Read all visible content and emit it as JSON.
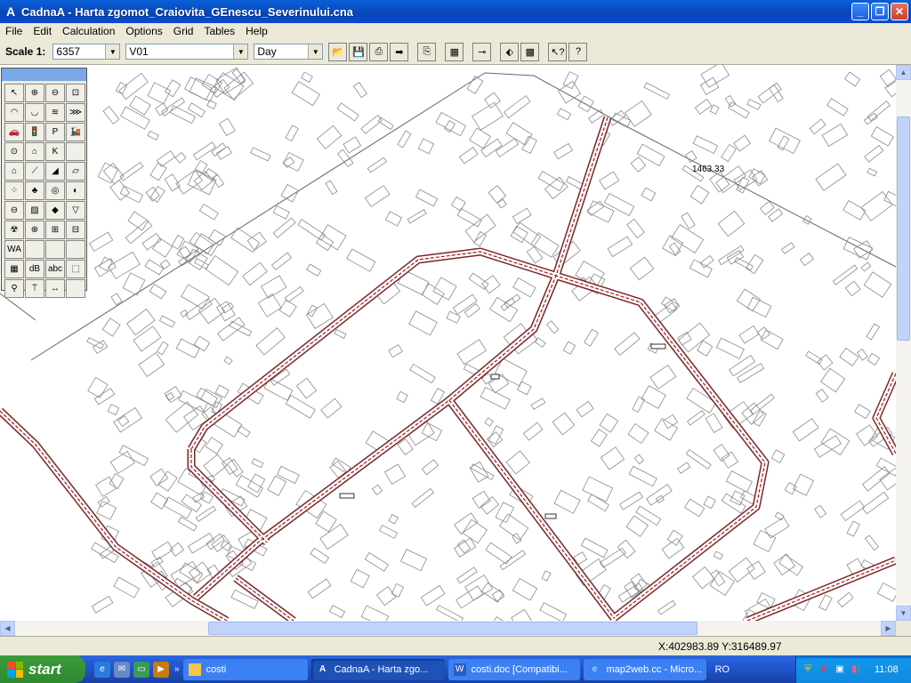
{
  "window": {
    "app_icon": "A",
    "title": "CadnaA - Harta zgomot_Craiovita_GEnescu_Severinului.cna",
    "buttons": [
      "minimize",
      "maximize",
      "close"
    ]
  },
  "menu": [
    "File",
    "Edit",
    "Calculation",
    "Options",
    "Grid",
    "Tables",
    "Help"
  ],
  "toolbar": {
    "scale_label": "Scale 1:",
    "scale_value": "6357",
    "variant_value": "V01",
    "period_value": "Day",
    "tool_icons": [
      "open-icon",
      "save-icon",
      "print-icon",
      "export-icon",
      "copy-icon",
      "calculator-icon",
      "pin-icon",
      "tag-icon",
      "grid-icon",
      "help-pointer-icon",
      "help-icon"
    ]
  },
  "map": {
    "label": "1463.33",
    "road_color": "#8b1a1a",
    "line_color": "#707070"
  },
  "palette": {
    "tools": [
      {
        "name": "select-arrow-icon",
        "glyph": "↖"
      },
      {
        "name": "zoom-in-icon",
        "glyph": "⊕"
      },
      {
        "name": "zoom-out-icon",
        "glyph": "⊖"
      },
      {
        "name": "zoom-extents-icon",
        "glyph": "⊡"
      },
      {
        "name": "point-source-icon",
        "glyph": "◠"
      },
      {
        "name": "line-source-icon",
        "glyph": "◡"
      },
      {
        "name": "area-source-icon",
        "glyph": "≋"
      },
      {
        "name": "vertical-area-source-icon",
        "glyph": "⋙"
      },
      {
        "name": "road-car-icon",
        "glyph": "🚗"
      },
      {
        "name": "traffic-light-icon",
        "glyph": "🚦"
      },
      {
        "name": "parking-icon",
        "glyph": "P"
      },
      {
        "name": "railway-icon",
        "glyph": "🚂"
      },
      {
        "name": "industry-icon",
        "glyph": "⊙"
      },
      {
        "name": "tunnel-icon",
        "glyph": "⌂"
      },
      {
        "name": "k-icon",
        "glyph": "K"
      },
      {
        "name": "blank-tool-1",
        "glyph": ""
      },
      {
        "name": "building-icon",
        "glyph": "⌂"
      },
      {
        "name": "barrier-icon",
        "glyph": "⟋"
      },
      {
        "name": "embankment-icon",
        "glyph": "◢"
      },
      {
        "name": "cylinder-icon",
        "glyph": "▱"
      },
      {
        "name": "scatter-points-icon",
        "glyph": "⁘"
      },
      {
        "name": "trees-icon",
        "glyph": "♣"
      },
      {
        "name": "contour-icon",
        "glyph": "◎"
      },
      {
        "name": "fixed-point-icon",
        "glyph": "◐"
      },
      {
        "name": "tank-icon",
        "glyph": "⊖"
      },
      {
        "name": "area-fill-icon",
        "glyph": "▨"
      },
      {
        "name": "terrain-icon",
        "glyph": "◆"
      },
      {
        "name": "triangle-down-icon",
        "glyph": "▽"
      },
      {
        "name": "radiation-icon",
        "glyph": "☢"
      },
      {
        "name": "globe-icon",
        "glyph": "⊕"
      },
      {
        "name": "receiver-grid-icon",
        "glyph": "⊞"
      },
      {
        "name": "facade-icon",
        "glyph": "⊟"
      },
      {
        "name": "wa-icon",
        "glyph": "WA"
      },
      {
        "name": "blank-tool-2",
        "glyph": ""
      },
      {
        "name": "blank-tool-3",
        "glyph": ""
      },
      {
        "name": "blank-tool-4",
        "glyph": ""
      },
      {
        "name": "bitmap-icon",
        "glyph": "▦"
      },
      {
        "name": "db-icon",
        "glyph": "dB"
      },
      {
        "name": "text-tool-icon",
        "glyph": "abc"
      },
      {
        "name": "frame-tool-icon",
        "glyph": "⬚"
      },
      {
        "name": "measure-icon",
        "glyph": "⚲"
      },
      {
        "name": "marker-icon",
        "glyph": "⍑"
      },
      {
        "name": "dimension-icon",
        "glyph": "↔"
      },
      {
        "name": "blank-tool-5",
        "glyph": ""
      }
    ]
  },
  "status": {
    "coords": "X:402983.89 Y:316489.97"
  },
  "taskbar": {
    "start_label": "start",
    "tasks": [
      {
        "label": "costi",
        "icon": "folder-icon",
        "active": false
      },
      {
        "label": "CadnaA - Harta zgo...",
        "icon": "cadnaa-icon",
        "active": true
      },
      {
        "label": "costi.doc [Compatibi...",
        "icon": "word-icon",
        "active": false
      },
      {
        "label": "map2web.cc - Micro...",
        "icon": "ie-icon",
        "active": false
      }
    ],
    "language": "RO",
    "clock": "11:08"
  }
}
